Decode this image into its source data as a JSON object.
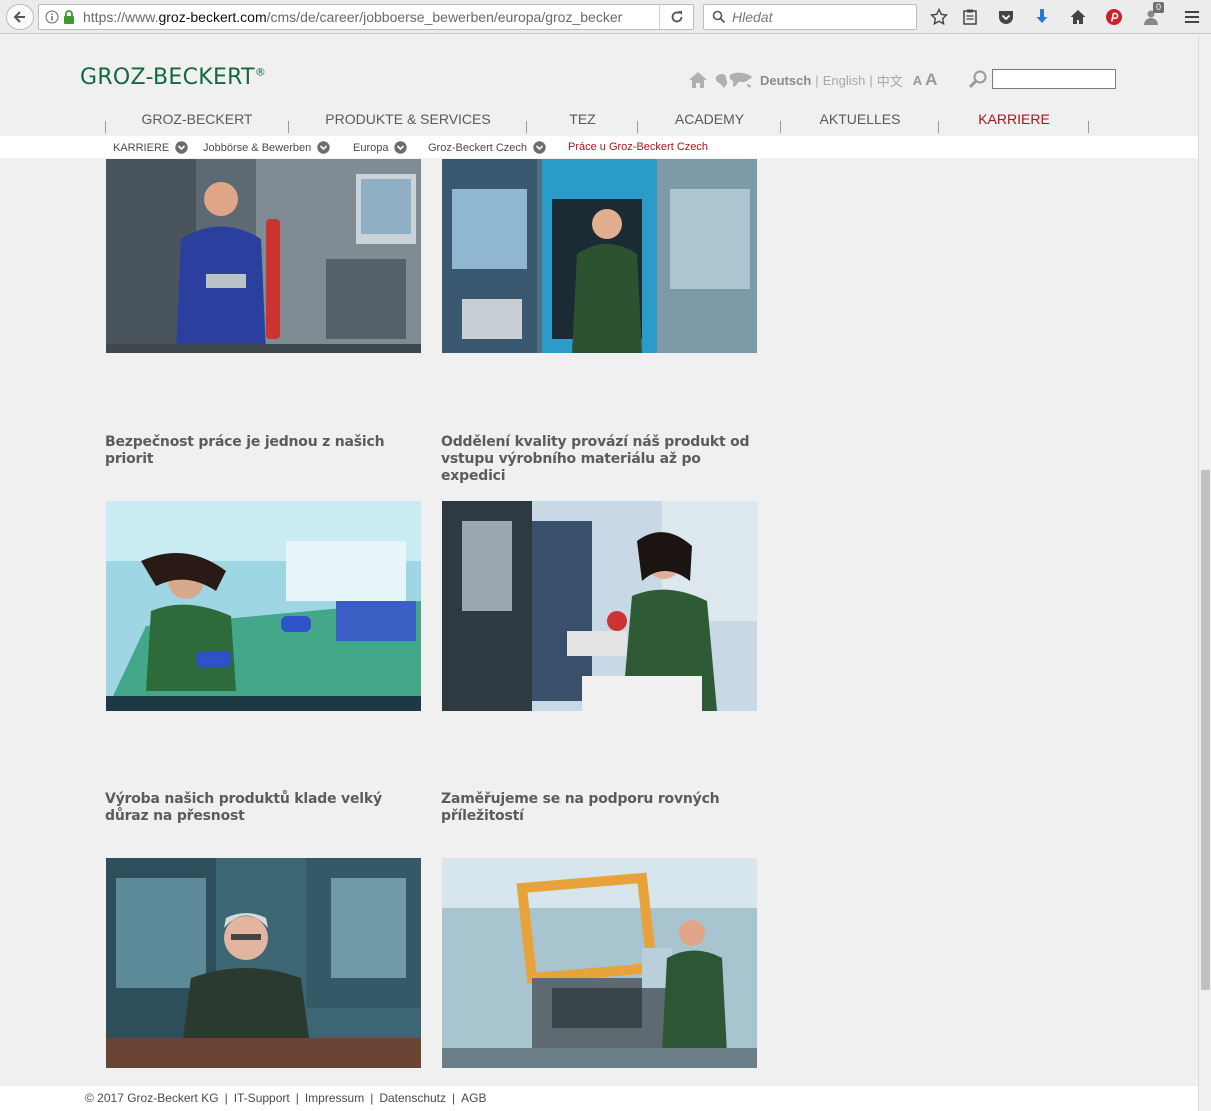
{
  "browser": {
    "url_prefix": "https://www.",
    "url_domain": "groz-beckert.com",
    "url_path": "/cms/de/career/jobboerse_bewerben/europa/groz_beckert_c",
    "search_placeholder": "Hledat",
    "notification_count": "0"
  },
  "header": {
    "logo_text": "GROZ-BECKERT",
    "logo_mark": "®",
    "lang_active": "Deutsch",
    "lang_english": "English",
    "lang_chinese": "中文",
    "separator": "|",
    "font_small": "A",
    "font_large": "A"
  },
  "main_nav": [
    {
      "label": "GROZ-BECKERT",
      "active": false
    },
    {
      "label": "PRODUKTE & SERVICES",
      "active": false
    },
    {
      "label": "TEZ",
      "active": false
    },
    {
      "label": "ACADEMY",
      "active": false
    },
    {
      "label": "AKTUELLES",
      "active": false
    },
    {
      "label": "KARRIERE",
      "active": true
    }
  ],
  "breadcrumb": [
    {
      "label": "KARRIERE"
    },
    {
      "label": "Jobbörse & Bewerben"
    },
    {
      "label": "Europa"
    },
    {
      "label": "Groz-Beckert Czech"
    },
    {
      "label": "Práce u Groz-Beckert Czech"
    }
  ],
  "gallery": {
    "captions": [
      "Bezpečnost práce je jednou z našich priorit",
      "Oddělení kvality provází náš produkt  od vstupu výrobního materiálu až po expedici",
      "Výroba našich produktů klade velký důraz na přesnost",
      "Zaměřujeme se na podporu rovných příležitostí"
    ]
  },
  "footer": {
    "copyright": "© 2017 Groz-Beckert KG",
    "links": [
      "IT-Support",
      "Impressum",
      "Datenschutz",
      "AGB"
    ],
    "separator": "|"
  },
  "colors": {
    "brand_green": "#14683e",
    "active_red": "#b1121a",
    "page_bg": "#f0f0f0"
  }
}
